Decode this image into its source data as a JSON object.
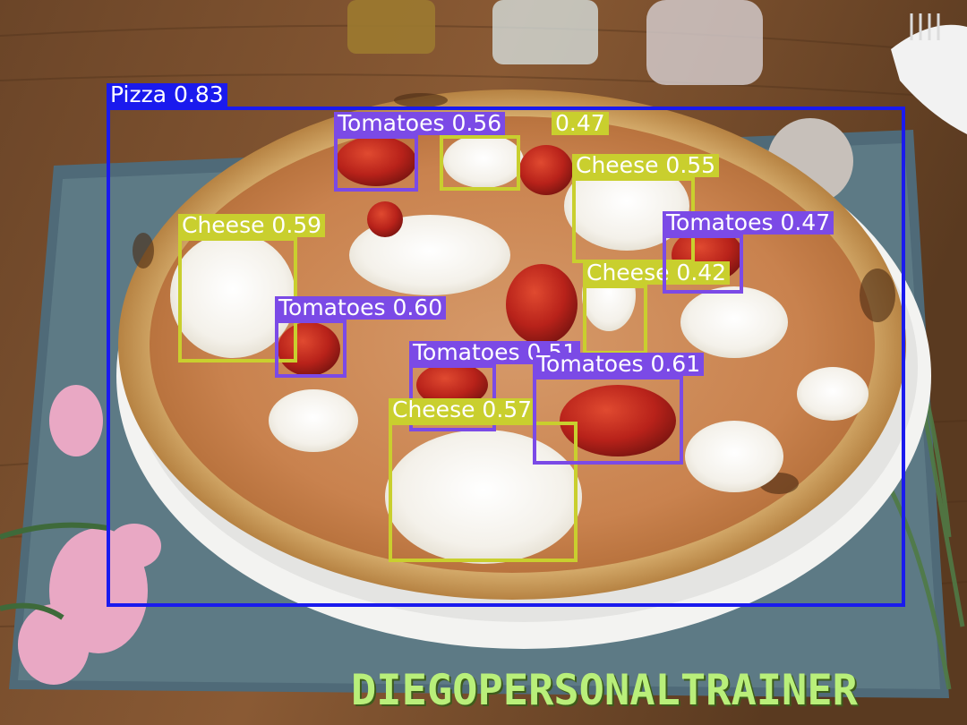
{
  "detections": [
    {
      "label": "Pizza 0.83",
      "class": "pizza"
    },
    {
      "label": "Tomatoes 0.56",
      "class": "tomato"
    },
    {
      "label": "0.47",
      "class": "cheese"
    },
    {
      "label": "Cheese 0.55",
      "class": "cheese"
    },
    {
      "label": "Tomatoes 0.47",
      "class": "tomato"
    },
    {
      "label": "Cheese 0.59",
      "class": "cheese"
    },
    {
      "label": "Cheese 0.42",
      "class": "cheese"
    },
    {
      "label": "Tomatoes 0.60",
      "class": "tomato"
    },
    {
      "label": "Tomatoes 0.51",
      "class": "tomato"
    },
    {
      "label": "Tomatoes 0.61",
      "class": "tomato"
    },
    {
      "label": "Cheese 0.57",
      "class": "cheese"
    }
  ],
  "watermark": "DIEGOPERSONALTRAINER",
  "colors": {
    "pizza_box": "#1a1aee",
    "tomatoes_box": "#7b4ae6",
    "cheese_box": "#c9cf2e",
    "watermark": "#b9ef7a"
  }
}
